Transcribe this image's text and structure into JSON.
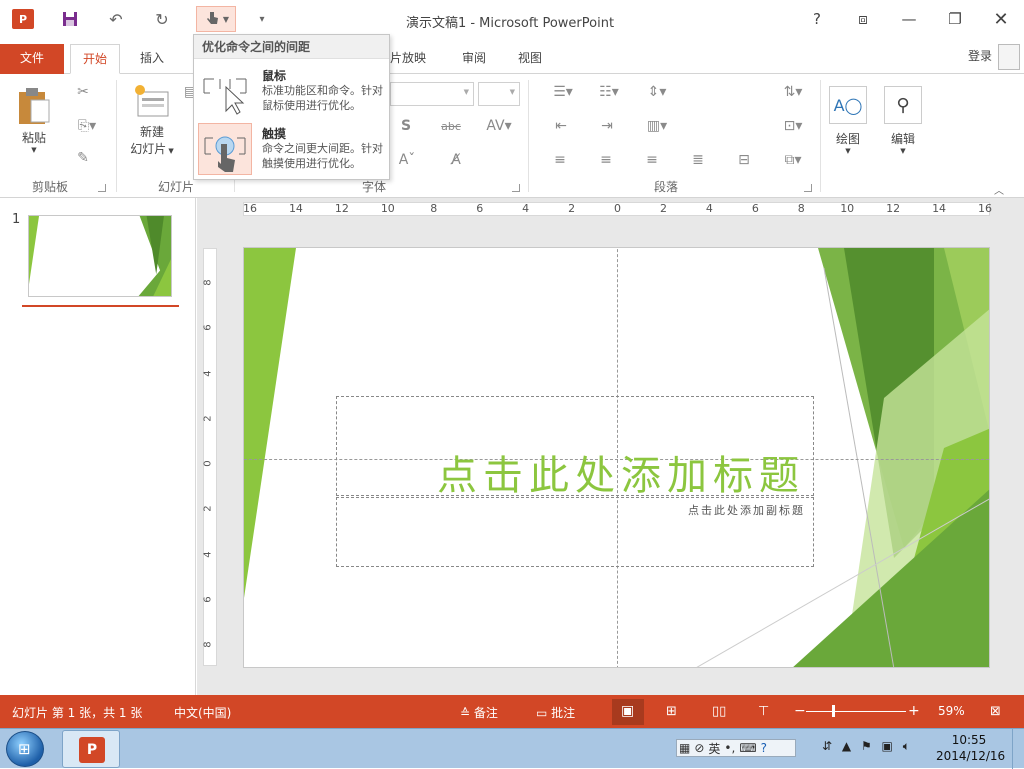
{
  "window": {
    "title": "演示文稿1 - Microsoft PowerPoint",
    "logo": "P"
  },
  "tabs": [
    {
      "label": "文件"
    },
    {
      "label": "开始"
    },
    {
      "label": "插入"
    },
    {
      "label": "片放映"
    },
    {
      "label": "审阅"
    },
    {
      "label": "视图"
    }
  ],
  "account": {
    "login": "登录"
  },
  "ribbon": {
    "clipboard": {
      "paste": "粘贴",
      "group": "剪贴板"
    },
    "slides": {
      "new_slide_1": "新建",
      "new_slide_2": "幻灯片",
      "group": "幻灯片"
    },
    "font": {
      "group": "字体"
    },
    "paragraph": {
      "group": "段落"
    },
    "drawing": {
      "label": "绘图"
    },
    "editing": {
      "label": "编辑"
    }
  },
  "touch_menu": {
    "header": "优化命令之间的间距",
    "mouse": {
      "title": "鼠标",
      "desc": "标准功能区和命令。针对鼠标使用进行优化。"
    },
    "touch": {
      "title": "触摸",
      "desc": "命令之间更大间距。针对触摸使用进行优化。"
    }
  },
  "thumbnails": {
    "number": "1"
  },
  "ruler": {
    "h_ticks": [
      "16",
      "14",
      "12",
      "10",
      "8",
      "6",
      "4",
      "2",
      "0",
      "2",
      "4",
      "6",
      "8",
      "10",
      "12",
      "14",
      "16"
    ],
    "v_ticks": [
      "8",
      "6",
      "4",
      "2",
      "0",
      "2",
      "4",
      "6",
      "8"
    ]
  },
  "slide": {
    "title_placeholder": "点击此处添加标题",
    "subtitle_placeholder": "点击此处添加副标题"
  },
  "status": {
    "slide_count": "幻灯片 第 1 张，共 1 张",
    "language": "中文(中国)",
    "notes": "备注",
    "comments": "批注",
    "zoom": "59%"
  },
  "taskbar": {
    "ime": "英",
    "time": "10:55",
    "date": "2014/12/16"
  },
  "colors": {
    "accent": "#d24726",
    "green_dark": "#4f8a2b",
    "green": "#8cc63f",
    "green_light": "#c6e39a"
  }
}
